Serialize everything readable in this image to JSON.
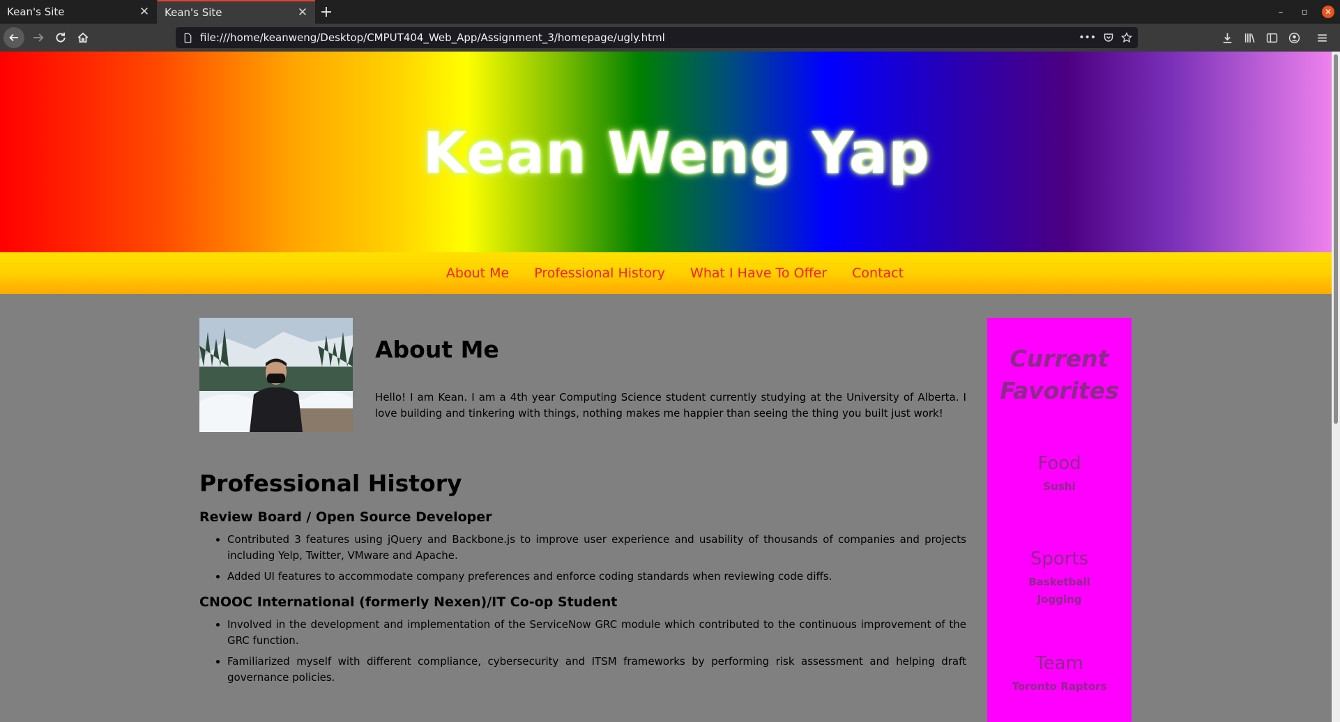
{
  "browser": {
    "tabs": [
      {
        "title": "Kean's Site",
        "active": false
      },
      {
        "title": "Kean's Site",
        "active": true
      }
    ],
    "new_tab_label": "+",
    "url": "file:///home/keanweng/Desktop/CMPUT404_Web_App/Assignment_3/homepage/ugly.html",
    "url_more": "•••",
    "close_glyph": "✕",
    "min_glyph": "–",
    "restore_glyph": "▫"
  },
  "header": {
    "title": "Kean Weng Yap"
  },
  "nav": {
    "items": [
      "About Me",
      "Professional History",
      "What I Have To Offer",
      "Contact"
    ]
  },
  "about": {
    "title": "About Me",
    "text": "Hello! I am Kean. I am a 4th year Computing Science student currently studying at the University of Alberta. I love building and tinkering with things, nothing makes me happier than seeing the thing you built just work!"
  },
  "history": {
    "title": "Professional History",
    "jobs": [
      {
        "title": "Review Board / Open Source Developer",
        "bullets": [
          "Contributed 3 features using jQuery and Backbone.js to improve user experience and usability of thousands of companies and projects including Yelp, Twitter, VMware and Apache.",
          "Added UI features to accommodate company preferences and enforce coding standards when reviewing code diffs."
        ]
      },
      {
        "title": "CNOOC International (formerly Nexen)/IT Co-op Student",
        "bullets": [
          "Involved in the development and implementation of the ServiceNow GRC module which contributed to the continuous improvement of the GRC function.",
          "Familiarized myself with different compliance, cybersecurity and ITSM frameworks by performing risk assessment and helping draft governance policies."
        ]
      }
    ]
  },
  "sidebar": {
    "title_line1": "Current",
    "title_line2": "Favorites",
    "food": {
      "heading": "Food",
      "items": [
        "Sushi"
      ]
    },
    "sports": {
      "heading": "Sports",
      "items": [
        "Basketball",
        "Jogging"
      ]
    },
    "team": {
      "heading": "Team",
      "items": [
        "Toronto Raptors"
      ]
    }
  },
  "colors": {
    "nav_link": "#ff1a1a",
    "sidebar_bg": "#ff00ff",
    "page_bg": "#808080"
  }
}
